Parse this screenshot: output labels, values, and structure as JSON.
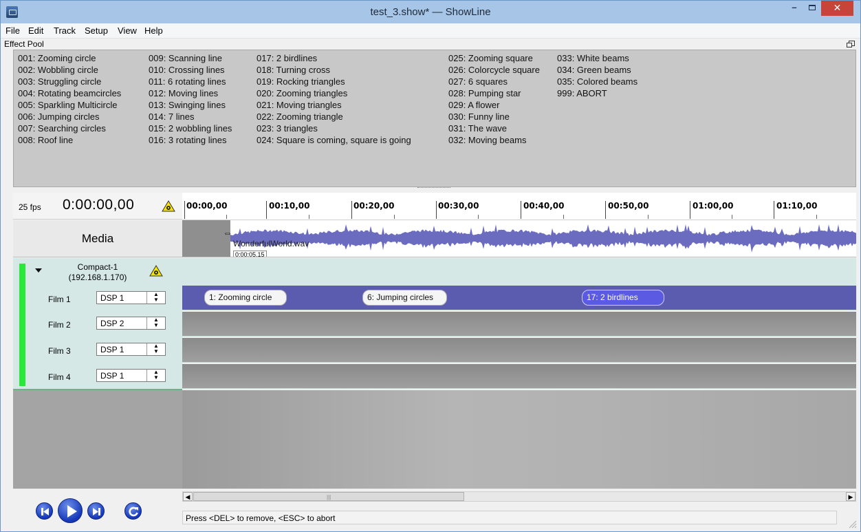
{
  "window": {
    "title": "test_3.show* — ShowLine",
    "close_glyph": "✕",
    "min_glyph": "–"
  },
  "menu": [
    "File",
    "Edit",
    "Track",
    "Setup",
    "View",
    "Help"
  ],
  "effect_pool": {
    "title": "Effect Pool",
    "columns": [
      [
        "001: Zooming circle",
        "002: Wobbling circle",
        "003: Struggling circle",
        "004: Rotating beamcircles",
        "005: Sparkling Multicircle",
        "006: Jumping circles",
        "007: Searching circles",
        "008: Roof line"
      ],
      [
        "009: Scanning line",
        "010: Crossing lines",
        "011: 6 rotating lines",
        "012: Moving lines",
        "013: Swinging lines",
        "014: 7 lines",
        "015: 2 wobbling lines",
        "016: 3 rotating lines"
      ],
      [
        "017: 2 birdlines",
        "018: Turning cross",
        "019: Rocking triangles",
        "020: Zooming triangles",
        "021: Moving triangles",
        "022: Zooming triangle",
        "023: 3 triangles",
        "024: Square is coming, square is going"
      ],
      [
        "025: Zooming square",
        "026: Colorcycle square",
        "027: 6 squares",
        "028: Pumping star",
        "029: A flower",
        "030: Funny line",
        "031: The wave",
        "032: Moving beams"
      ],
      [
        "033: White beams",
        "034: Green beams",
        "035: Colored beams",
        "999: ABORT"
      ]
    ]
  },
  "timeline": {
    "fps": "25 fps",
    "time": "0:00:00,00",
    "ruler_labels": [
      "00:00,00",
      "00:10,00",
      "00:20,00",
      "00:30,00",
      "00:40,00",
      "00:50,00",
      "01:00,00",
      "01:10,00"
    ]
  },
  "media": {
    "label": "Media",
    "file": "WonderfulWorld.wav",
    "cursor_time": "0:00:05,15",
    "cursor_glyph": "⇔",
    "waveform_color": "#6b6bc0"
  },
  "device": {
    "name": "Compact-1",
    "ip": "(192.168.1.170)",
    "status_color": "#28e83a"
  },
  "films": [
    {
      "label": "Film 1",
      "dsp": "DSP 1"
    },
    {
      "label": "Film 2",
      "dsp": "DSP 2"
    },
    {
      "label": "Film 3",
      "dsp": "DSP 1"
    },
    {
      "label": "Film 4",
      "dsp": "DSP 1"
    }
  ],
  "effects_on_film1": [
    {
      "label": "1: Zooming circle",
      "selected": false
    },
    {
      "label": "6: Jumping circles",
      "selected": false
    },
    {
      "label": "17: 2 birdlines",
      "selected": true
    }
  ],
  "transport": {
    "buttons": [
      "rewind-icon",
      "play-icon",
      "skip-to-end-icon",
      "loop-icon"
    ],
    "accent": "#1638b8"
  },
  "scrollbar": {
    "left_glyph": "◀",
    "right_glyph": "▶",
    "grip": "|||"
  },
  "status": {
    "text": "Press <DEL> to remove, <ESC> to abort"
  }
}
